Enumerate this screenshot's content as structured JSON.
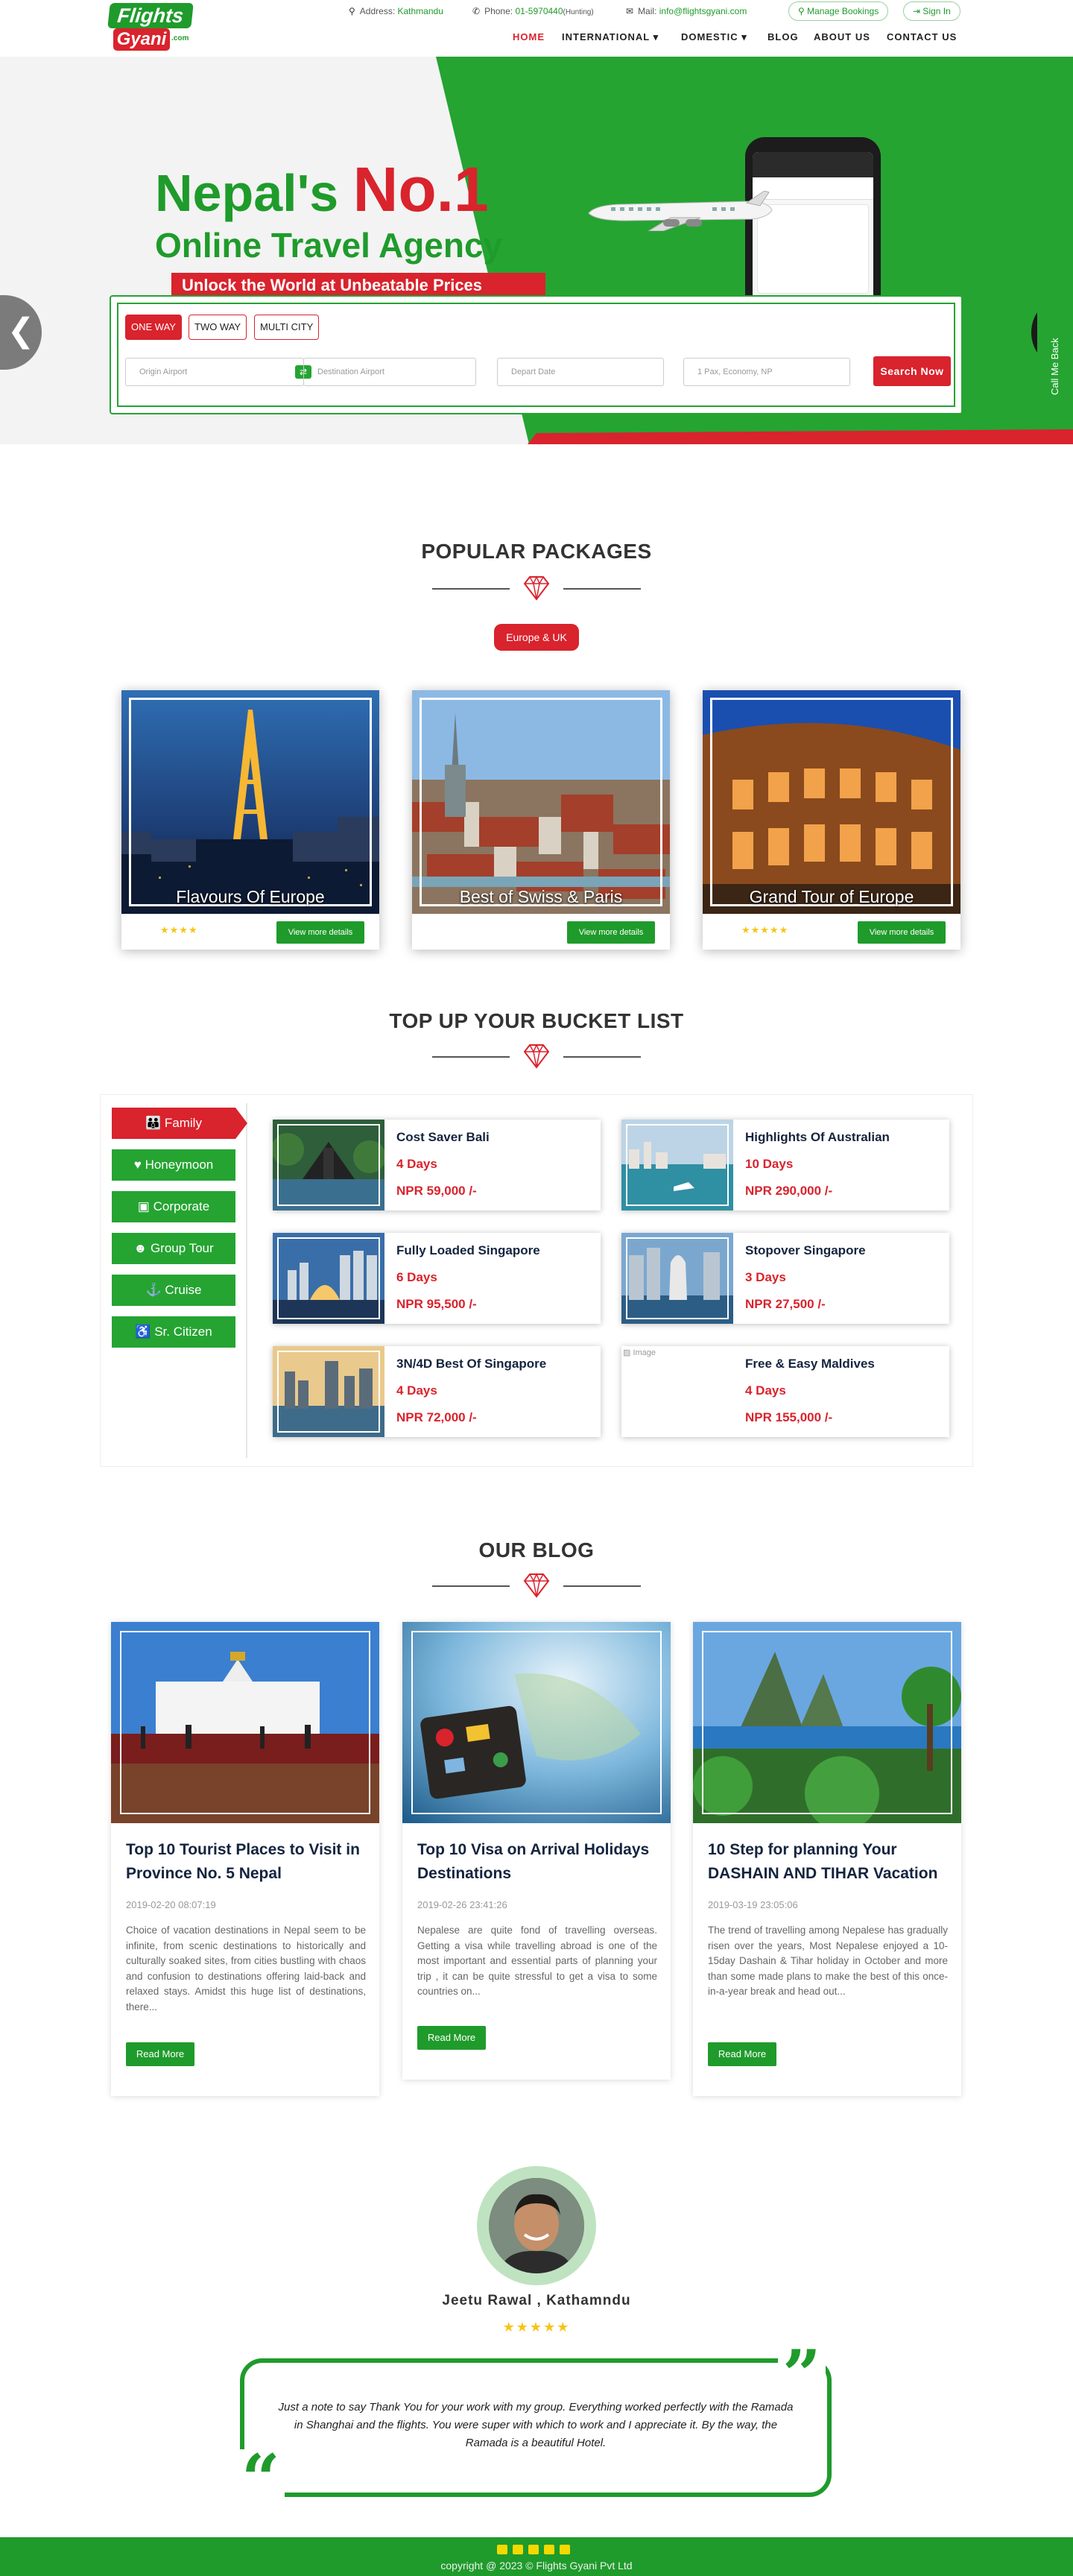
{
  "brand": {
    "logo_top": "Flights",
    "logo_bottom": "Gyani",
    "logo_suffix": ".com"
  },
  "topbar": {
    "address_label": "Address:",
    "address_value": "Kathmandu",
    "phone_label": "Phone:",
    "phone_value": "01-5970440",
    "phone_note": "(Hunting)",
    "mail_label": "Mail:",
    "mail_value": "info@flightsgyani.com",
    "manage_bookings": "Manage Bookings",
    "sign_in": "Sign In"
  },
  "nav": {
    "home": "HOME",
    "international": "INTERNATIONAL",
    "domestic": "DOMESTIC",
    "blog": "BLOG",
    "about": "ABOUT US",
    "contact": "CONTACT US"
  },
  "hero": {
    "line1": "Nepal's",
    "line1_bold": "No.1",
    "line2": "Online Travel Agency",
    "ribbon": "Unlock the World at Unbeatable Prices",
    "call_me_back": "Call Me Back"
  },
  "search": {
    "trip_types": [
      "ONE WAY",
      "TWO WAY",
      "MULTI CITY"
    ],
    "origin_placeholder": "Origin Airport",
    "destination_placeholder": "Destination Airport",
    "depart_placeholder": "Depart Date",
    "pax_placeholder": "1 Pax, Economy, NP",
    "search_label": "Search Now"
  },
  "packages": {
    "heading": "POPULAR PACKAGES",
    "filter": "Europe & UK",
    "items": [
      {
        "name": "Flavours Of Europe",
        "stars": "★★★★",
        "button": "View more details"
      },
      {
        "name": "Best of Swiss & Paris",
        "stars": "",
        "button": "View more details"
      },
      {
        "name": "Grand Tour of Europe",
        "stars": "★★★★★",
        "button": "View more details"
      }
    ]
  },
  "bucket": {
    "heading": "TOP UP YOUR BUCKET LIST",
    "tabs": [
      {
        "label": "Family",
        "icon": "family-icon"
      },
      {
        "label": "Honeymoon",
        "icon": "honeymoon-icon"
      },
      {
        "label": "Corporate",
        "icon": "corporate-icon"
      },
      {
        "label": "Group Tour",
        "icon": "group-icon"
      },
      {
        "label": "Cruise",
        "icon": "cruise-icon"
      },
      {
        "label": "Sr. Citizen",
        "icon": "senior-icon"
      }
    ],
    "items": [
      {
        "title": "Cost Saver Bali",
        "days": "4 Days",
        "price": "NPR 59,000 /-"
      },
      {
        "title": "Highlights Of Australian",
        "days": "10 Days",
        "price": "NPR 290,000 /-"
      },
      {
        "title": "Fully Loaded Singapore",
        "days": "6 Days",
        "price": "NPR 95,500 /-"
      },
      {
        "title": "Stopover Singapore",
        "days": "3 Days",
        "price": "NPR 27,500 /-"
      },
      {
        "title": "3N/4D Best Of Singapore",
        "days": "4 Days",
        "price": "NPR 72,000 /-"
      },
      {
        "title": "Free & Easy Maldives",
        "days": "4 Days",
        "price": "NPR 155,000 /-",
        "broken_image_alt": "Image"
      }
    ]
  },
  "blog": {
    "heading": "OUR BLOG",
    "posts": [
      {
        "title": "Top 10 Tourist Places to Visit in Province No. 5 Nepal",
        "date": "2019-02-20 08:07:19",
        "excerpt": "Choice of vacation destinations in Nepal seem to be infinite, from scenic destinations to historically and culturally soaked sites, from cities bustling with chaos and confusion to destinations offering laid-back and relaxed stays. Amidst this huge list of destinations, there...",
        "button": "Read More"
      },
      {
        "title": "Top 10 Visa on Arrival Holidays Destinations",
        "date": "2019-02-26 23:41:26",
        "excerpt": "Nepalese are quite fond of travelling overseas. Getting a visa while travelling abroad is one of the most important and essential parts of planning your trip , it can be quite stressful to get a visa to some countries on...",
        "button": "Read More"
      },
      {
        "title": "10 Step for planning Your DASHAIN AND TIHAR Vacation",
        "date": "2019-03-19 23:05:06",
        "excerpt": "The trend of travelling among Nepalese has gradually risen over the years, Most Nepalese enjoyed a 10-15day Dashain & Tihar holiday in October and more than some made plans to make the best of this once-in-a-year break and head out...",
        "button": "Read More"
      }
    ]
  },
  "testimonial": {
    "name": "Jeetu Rawal , Kathamndu",
    "stars": "★★★★★",
    "quote": "Just a note to say Thank You for your work with my group. Everything worked perfectly with the Ramada in Shanghai and the flights. You were super with which to work and I appreciate it. By the way, the Ramada is a beautiful Hotel."
  },
  "footer": {
    "copyright": "copyright @ 2023 © Flights Gyani Pvt Ltd"
  },
  "colors": {
    "green": "#1f9b2b",
    "red": "#d9232d",
    "navy": "#14243f"
  }
}
